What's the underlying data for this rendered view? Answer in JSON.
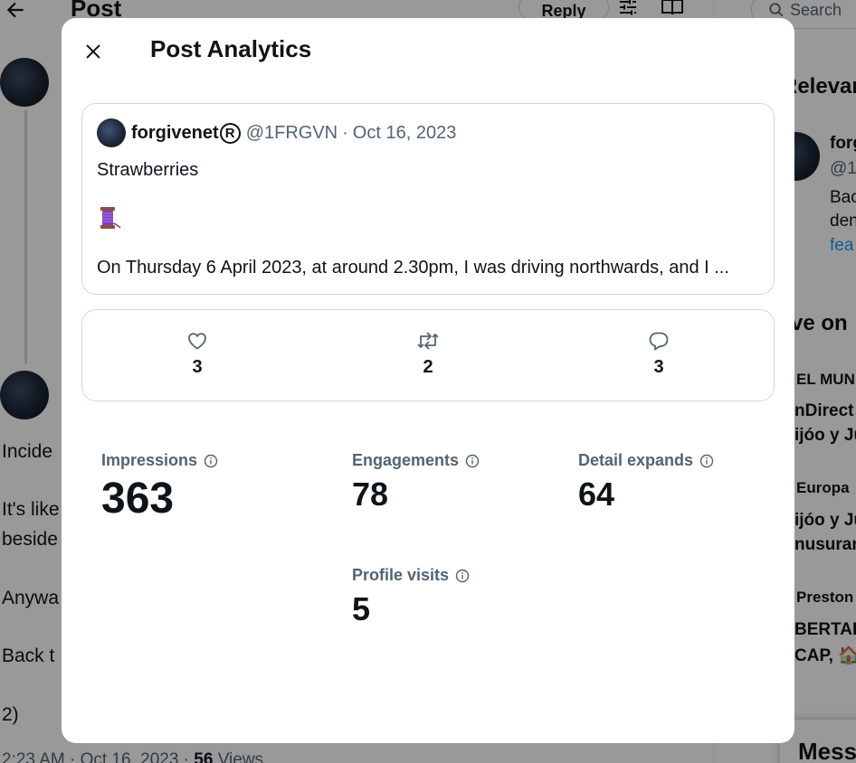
{
  "background": {
    "page_title": "Post",
    "reply_label": "Reply",
    "search_placeholder": "Search",
    "text_lines": [
      "Incide",
      "It's like",
      "beside",
      "Anywa",
      "Back t",
      "2)"
    ],
    "footer_time": "2:23 AM · Oct 16, 2023 · ",
    "footer_views": "56",
    "footer_views_label": " Views",
    "sidebar": {
      "relevant_heading": "Relevan",
      "relevant_name": "forg",
      "relevant_handle": "@1F",
      "relevant_bio_1": "Bac",
      "relevant_bio_2": "den",
      "relevant_bio_link": "fea",
      "live_heading": "ve on",
      "item1_source": "EL MUN",
      "item1_line1": "nDirect",
      "item1_line2": "ijóo y Ju",
      "item2_source": "Europa",
      "item2_line1": "ijóo y Ju",
      "item2_line2": "nusuran",
      "item3_source": "Preston",
      "item3_line1": "BERTAR",
      "item3_line2": "CAP, 🏠"
    },
    "messages_label": "Mess"
  },
  "modal": {
    "title": "Post Analytics",
    "post": {
      "display_name": "forgivenet",
      "registered_mark": "R",
      "handle": "@1FRGVN",
      "separator": "·",
      "date": "Oct 16, 2023",
      "text_line1": "Strawberries",
      "emoji": "thread-spool-emoji",
      "text_line3": "On Thursday 6 April 2023, at around 2.30pm, I was driving northwards, and I ..."
    },
    "engagement": {
      "likes": "3",
      "reposts": "2",
      "replies": "3"
    },
    "stats": {
      "impressions_label": "Impressions",
      "impressions_value": "363",
      "engagements_label": "Engagements",
      "engagements_value": "78",
      "detail_expands_label": "Detail expands",
      "detail_expands_value": "64",
      "profile_visits_label": "Profile visits",
      "profile_visits_value": "5"
    }
  },
  "colors": {
    "text_primary": "#0f1419",
    "text_secondary": "#536471",
    "border": "#cfd9de",
    "link": "#1d9bf0",
    "overlay": "rgba(0,0,0,0.4)"
  }
}
